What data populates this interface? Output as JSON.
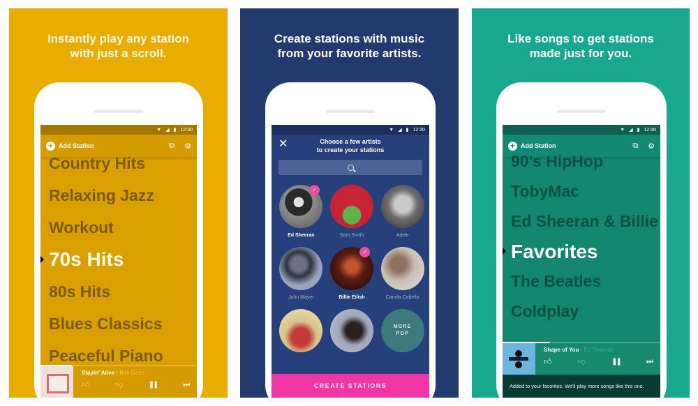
{
  "colors": {
    "panel_yellow": "#e8ad00",
    "panel_navy": "#233a6e",
    "panel_teal": "#17a88e",
    "accent_pink": "#f036a4"
  },
  "panels": [
    {
      "headline_line1": "Instantly play any station",
      "headline_line2": "with just a scroll.",
      "status": {
        "wifi_icon": "wifi-icon",
        "signal_icon": "signal-icon",
        "battery_icon": "battery-icon",
        "time": "12:30"
      },
      "appbar": {
        "add_label": "Add Station",
        "add_icon": "plus-circle-icon",
        "cast_icon": "cast-devices-icon",
        "settings_icon": "gear-icon"
      },
      "stations": [
        "Country Hits",
        "Relaxing Jazz",
        "Workout",
        "70s Hits",
        "80s Hits",
        "Blues Classics",
        "Peaceful Piano"
      ],
      "active_station": "70s Hits",
      "player": {
        "song": "Stayin' Alive",
        "separator": " • ",
        "artist": "Bee Gees",
        "progress_percent": 20,
        "like_icon": "👍",
        "dislike_icon": "👎",
        "pause_icon": "❚❚",
        "next_icon": "▶❙"
      }
    },
    {
      "headline_line1": "Create stations with music",
      "headline_line2": "from your favorite artists.",
      "status": {
        "time": "12:30"
      },
      "choose_title_line1": "Choose a few artists",
      "choose_title_line2": "to create your stations",
      "close_icon": "✕",
      "search_placeholder": "",
      "artists": [
        {
          "name": "Ed Sheeran",
          "selected": true
        },
        {
          "name": "Sam Smith",
          "selected": false
        },
        {
          "name": "Adele",
          "selected": false
        },
        {
          "name": "John Mayer",
          "selected": false
        },
        {
          "name": "Billie Eilish",
          "selected": true
        },
        {
          "name": "Camila Cabello",
          "selected": false
        },
        {
          "name": "",
          "selected": false
        },
        {
          "name": "",
          "selected": false
        }
      ],
      "more_tile_line1": "MORE",
      "more_tile_line2": "POP",
      "check_icon": "✓",
      "cta_label": "CREATE STATIONS"
    },
    {
      "headline_line1": "Like songs to get stations",
      "headline_line2": "made just for you.",
      "status": {
        "time": "12:30"
      },
      "appbar": {
        "add_label": "Add Station"
      },
      "stations": [
        "90's HipHop",
        "TobyMac",
        "Ed Sheeran & Billie",
        "Favorites",
        "The Beatles",
        "Coldplay"
      ],
      "active_station": "Favorites",
      "player": {
        "song": "Shape of You",
        "separator": " • ",
        "artist": "Ed Sheeran",
        "progress_percent": 30,
        "liked": true
      },
      "toast": "Added to your favorites. We'll play more songs like this one."
    }
  ]
}
